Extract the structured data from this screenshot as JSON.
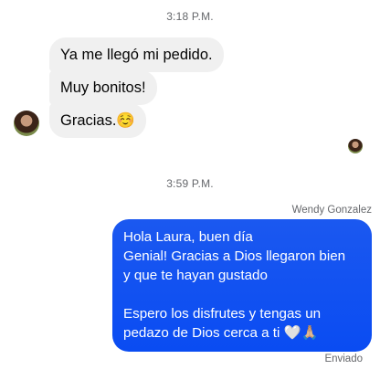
{
  "thread": {
    "timestamp_1": "3:18 P.M.",
    "timestamp_2": "3:59 P.M.",
    "incoming": [
      "Ya me llegó mi pedido.",
      "Muy bonitos!",
      "Gracias.☺️"
    ],
    "outgoing_sender": "Wendy Gonzalez",
    "outgoing_lines": [
      "Hola Laura, buen día",
      "Genial! Gracias a Dios llegaron bien",
      "y que te hayan gustado",
      "",
      "Espero los disfrutes y tengas un",
      "pedazo de Dios cerca a ti 🤍🙏🏼"
    ],
    "outgoing_status": "Enviado"
  },
  "colors": {
    "incoming_bubble": "#f0f0f0",
    "outgoing_bubble": "#0a4cf2",
    "meta_text": "#65676b"
  },
  "icons": {
    "contact_avatar": "contact-avatar",
    "read_receipt_avatar": "read-receipt-avatar"
  }
}
